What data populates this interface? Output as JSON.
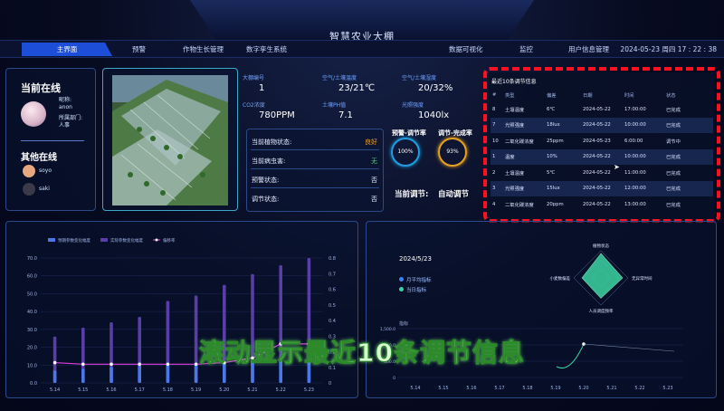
{
  "header": {
    "title": "智慧农业大棚",
    "datetime": "2024-05-23 周四 17 : 22 : 38"
  },
  "nav": {
    "items": [
      "主界面",
      "预警",
      "作物生长管理",
      "数字孪生系统",
      "数据可视化",
      "监控",
      "用户信息管理"
    ]
  },
  "online": {
    "title": "当前在线",
    "nickname_label": "昵称:",
    "nickname": "anon",
    "dept_label": "所属部门:",
    "dept": "人事",
    "others_title": "其他在线",
    "others": [
      "soyo",
      "saki"
    ]
  },
  "metrics": [
    {
      "label": "大棚编号",
      "value": "1"
    },
    {
      "label": "空气/土壤温度",
      "value": "23/21℃"
    },
    {
      "label": "空气/土壤湿度",
      "value": "20/32%"
    },
    {
      "label": "CO2浓度",
      "value": "780PPM"
    },
    {
      "label": "土壤PH值",
      "value": "7.1"
    },
    {
      "label": "光照强度",
      "value": "1040lx"
    }
  ],
  "status": [
    {
      "label": "当前植物状态:",
      "value": "良好",
      "color": "#f0a020"
    },
    {
      "label": "当前病虫害:",
      "value": "无",
      "color": "#3bd46a"
    },
    {
      "label": "预警状态:",
      "value": "否",
      "color": "#ffffff"
    },
    {
      "label": "调节状态:",
      "value": "否",
      "color": "#ffffff"
    }
  ],
  "rates": {
    "warn_label": "预警-调节率",
    "warn_value": "100%",
    "done_label": "调节-完成率",
    "done_value": "93%",
    "current_label": "当前调节:",
    "current_value": "自动调节"
  },
  "adjust_table": {
    "title": "最近10条调节信息",
    "headers": [
      "#",
      "类型",
      "偏差",
      "日期",
      "时间",
      "状态"
    ],
    "rows": [
      [
        "8",
        "土壤温度",
        "6℃",
        "2024-05-22",
        "17:00:00",
        "已完成"
      ],
      [
        "7",
        "光照强度",
        "18lux",
        "2024-05-22",
        "10:00:00",
        "已完成"
      ],
      [
        "10",
        "二氧化碳浓度",
        "25ppm",
        "2024-05-23",
        "6:00:00",
        "调节中"
      ],
      [
        "1",
        "温度",
        "10%",
        "2024-05-22",
        "10:00:00",
        "已完成"
      ],
      [
        "2",
        "土壤温度",
        "5℃",
        "2024-05-22",
        "11:00:00",
        "已完成"
      ],
      [
        "3",
        "光照强度",
        "15lux",
        "2024-05-22",
        "12:00:00",
        "已完成"
      ],
      [
        "4",
        "二氧化碳浓度",
        "20ppm",
        "2024-05-22",
        "13:00:00",
        "已完成"
      ]
    ]
  },
  "chart_data": [
    {
      "type": "bar",
      "categories": [
        "5.14",
        "5.15",
        "5.16",
        "5.17",
        "5.18",
        "5.19",
        "5.20",
        "5.21",
        "5.22",
        "5.23"
      ],
      "series": [
        {
          "name": "预期参数变化幅度",
          "values": [
            7,
            8,
            9,
            10,
            10,
            11,
            12,
            13,
            14,
            15
          ],
          "color": "#4a78e8"
        },
        {
          "name": "实际参数变化幅度",
          "values": [
            26,
            31,
            34,
            37,
            46,
            49,
            55,
            61,
            66,
            70
          ],
          "color": "#5a3ea8"
        },
        {
          "name": "偏移率",
          "values": [
            0.13,
            0.12,
            0.12,
            0.12,
            0.12,
            0.12,
            0.13,
            0.16,
            0.25,
            0.25
          ],
          "color": "#e23fe0"
        }
      ],
      "ylim": [
        0,
        70
      ],
      "y2lim": [
        0,
        0.8
      ],
      "yticks": [
        "0.0",
        "10.0",
        "20.0",
        "30.0",
        "40.0",
        "50.0",
        "60.0",
        "70.0"
      ],
      "y2ticks": [
        "0",
        "0.1",
        "0.2",
        "0.3",
        "0.4",
        "0.5",
        "0.6",
        "0.7",
        "0.8"
      ]
    },
    {
      "type": "radar",
      "axes": [
        "植物状态",
        "无异常时间",
        "人员调度频率",
        "小麦数偏差"
      ],
      "values": [
        0.9,
        0.8,
        0.75,
        0.7
      ]
    }
  ],
  "right_chart": {
    "date": "2024/5/23",
    "legend": [
      "月平均指标",
      "当日指标"
    ],
    "yunit": "指标",
    "yticks": [
      "0",
      "500.0",
      "1,000.0",
      "1,500.0"
    ],
    "xticks": [
      "5.14",
      "5.15",
      "5.16",
      "5.17",
      "5.18",
      "5.19",
      "5.20",
      "5.21",
      "5.22",
      "5.23"
    ]
  },
  "overlay": {
    "caption": "滚动显示最近10条调节信息"
  }
}
